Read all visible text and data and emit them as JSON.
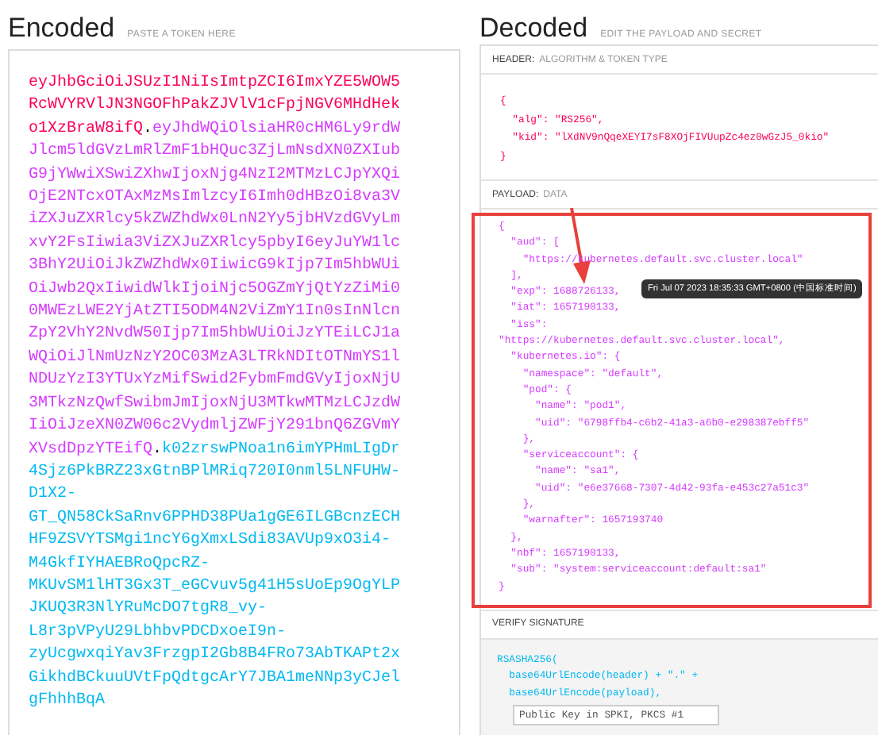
{
  "encoded": {
    "title": "Encoded",
    "hint": "PASTE A TOKEN HERE",
    "lines": [
      [
        {
          "kind": "header",
          "text": "eyJhbGciOiJSUzI1NiIsImtpZCI6ImxYZE5WOW5"
        }
      ],
      [
        {
          "kind": "header",
          "text": "RcWVYRVlJN3NGOFhPakZJVlV1cFpjNGV6MHdHek"
        }
      ],
      [
        {
          "kind": "header",
          "text": "o1XzBraW8ifQ"
        },
        {
          "kind": "dot",
          "text": "."
        },
        {
          "kind": "payload",
          "text": "eyJhdWQiOlsiaHR0cHM6Ly9rdW"
        }
      ],
      [
        {
          "kind": "payload",
          "text": "Jlcm5ldGVzLmRlZmF1bHQuc3ZjLmNsdXN0ZXIub"
        }
      ],
      [
        {
          "kind": "payload",
          "text": "G9jYWwiXSwiZXhwIjoxNjg4NzI2MTMzLCJpYXQi"
        }
      ],
      [
        {
          "kind": "payload",
          "text": "OjE2NTcxOTAxMzMsImlzcyI6Imh0dHBzOi8va3V"
        }
      ],
      [
        {
          "kind": "payload",
          "text": "iZXJuZXRlcy5kZWZhdWx0LnN2Yy5jbHVzdGVyLm"
        }
      ],
      [
        {
          "kind": "payload",
          "text": "xvY2FsIiwia3ViZXJuZXRlcy5pbyI6eyJuYW1lc"
        }
      ],
      [
        {
          "kind": "payload",
          "text": "3BhY2UiOiJkZWZhdWx0IiwicG9kIjp7Im5hbWUi"
        }
      ],
      [
        {
          "kind": "payload",
          "text": "OiJwb2QxIiwidWlkIjoiNjc5OGZmYjQtYzZiMi0"
        }
      ],
      [
        {
          "kind": "payload",
          "text": "0MWEzLWE2YjAtZTI5ODM4N2ViZmY1In0sInNlcn"
        }
      ],
      [
        {
          "kind": "payload",
          "text": "ZpY2VhY2NvdW50Ijp7Im5hbWUiOiJzYTEiLCJ1a"
        }
      ],
      [
        {
          "kind": "payload",
          "text": "WQiOiJlNmUzNzY2OC03MzA3LTRkNDItOTNmYS1l"
        }
      ],
      [
        {
          "kind": "payload",
          "text": "NDUzYzI3YTUxYzMifSwid2FybmFmdGVyIjoxNjU"
        }
      ],
      [
        {
          "kind": "payload",
          "text": "3MTkzNzQwfSwibmJmIjoxNjU3MTkwMTMzLCJzdW"
        }
      ],
      [
        {
          "kind": "payload",
          "text": "IiOiJzeXN0ZW06c2VydmljZWFjY291bnQ6ZGVmY"
        }
      ],
      [
        {
          "kind": "payload",
          "text": "XVsdDpzYTEifQ"
        },
        {
          "kind": "dot",
          "text": "."
        },
        {
          "kind": "signature",
          "text": "k02zrswPNoa1n6imYPHmLIgDr"
        }
      ],
      [
        {
          "kind": "signature",
          "text": "4Sjz6PkBRZ23xGtnBPlMRiq720I0nml5LNFUHW-"
        }
      ],
      [
        {
          "kind": "signature",
          "text": "D1X2-"
        }
      ],
      [
        {
          "kind": "signature",
          "text": "GT_QN58CkSaRnv6PPHD38PUa1gGE6ILGBcnzECH"
        }
      ],
      [
        {
          "kind": "signature",
          "text": "HF9ZSVYTSMgi1ncY6gXmxLSdi83AVUp9xO3i4-"
        }
      ],
      [
        {
          "kind": "signature",
          "text": "M4GkfIYHAEBRoQpcRZ-"
        }
      ],
      [
        {
          "kind": "signature",
          "text": "MKUvSM1lHT3Gx3T_eGCvuv5g41H5sUoEp9OgYLP"
        }
      ],
      [
        {
          "kind": "signature",
          "text": "JKUQ3R3NlYRuMcDO7tgR8_vy-"
        }
      ],
      [
        {
          "kind": "signature",
          "text": "L8r3pVPyU29LbhbvPDCDxoeI9n-"
        }
      ],
      [
        {
          "kind": "signature",
          "text": "zyUcgwxqiYav3FrzgpI2Gb8B4FRo73AbTKAPt2x"
        }
      ],
      [
        {
          "kind": "signature",
          "text": "GikhdBCkuuUVtFpQdtgcArY7JBA1meNNp3yCJel"
        }
      ],
      [
        {
          "kind": "signature",
          "text": "gFhhhBqA"
        }
      ]
    ]
  },
  "decoded": {
    "title": "Decoded",
    "hint": "EDIT THE PAYLOAD AND SECRET",
    "header": {
      "label": "HEADER:",
      "sublabel": "ALGORITHM & TOKEN TYPE",
      "lines": [
        "{",
        "  \"alg\": \"RS256\",",
        "  \"kid\": \"lXdNV9nQqeXEYI7sF8XOjFIVUupZc4ez0wGzJ5_0kio\"",
        "}"
      ]
    },
    "payload": {
      "label": "PAYLOAD:",
      "sublabel": "DATA",
      "lines": [
        "{",
        "  \"aud\": [",
        "    \"https://kubernetes.default.svc.cluster.local\"",
        "  ],",
        "  \"exp\": 1688726133,",
        "  \"iat\": 1657190133,",
        "  \"iss\":",
        "\"https://kubernetes.default.svc.cluster.local\",",
        "  \"kubernetes.io\": {",
        "    \"namespace\": \"default\",",
        "    \"pod\": {",
        "      \"name\": \"pod1\",",
        "      \"uid\": \"6798ffb4-c6b2-41a3-a6b0-e298387ebff5\"",
        "    },",
        "    \"serviceaccount\": {",
        "      \"name\": \"sa1\",",
        "      \"uid\": \"e6e37668-7307-4d42-93fa-e453c27a51c3\"",
        "    },",
        "    \"warnafter\": 1657193740",
        "  },",
        "  \"nbf\": 1657190133,",
        "  \"sub\": \"system:serviceaccount:default:sa1\"",
        "}"
      ],
      "tooltip": "Fri Jul 07 2023 18:35:33 GMT+0800 (中国标准时间)"
    },
    "signature": {
      "label": "VERIFY SIGNATURE",
      "lines": [
        "RSASHA256(",
        "  base64UrlEncode(header) + \".\" +",
        "  base64UrlEncode(payload),"
      ],
      "key_input": {
        "placeholder": "Public Key in SPKI, PKCS #1"
      }
    }
  }
}
